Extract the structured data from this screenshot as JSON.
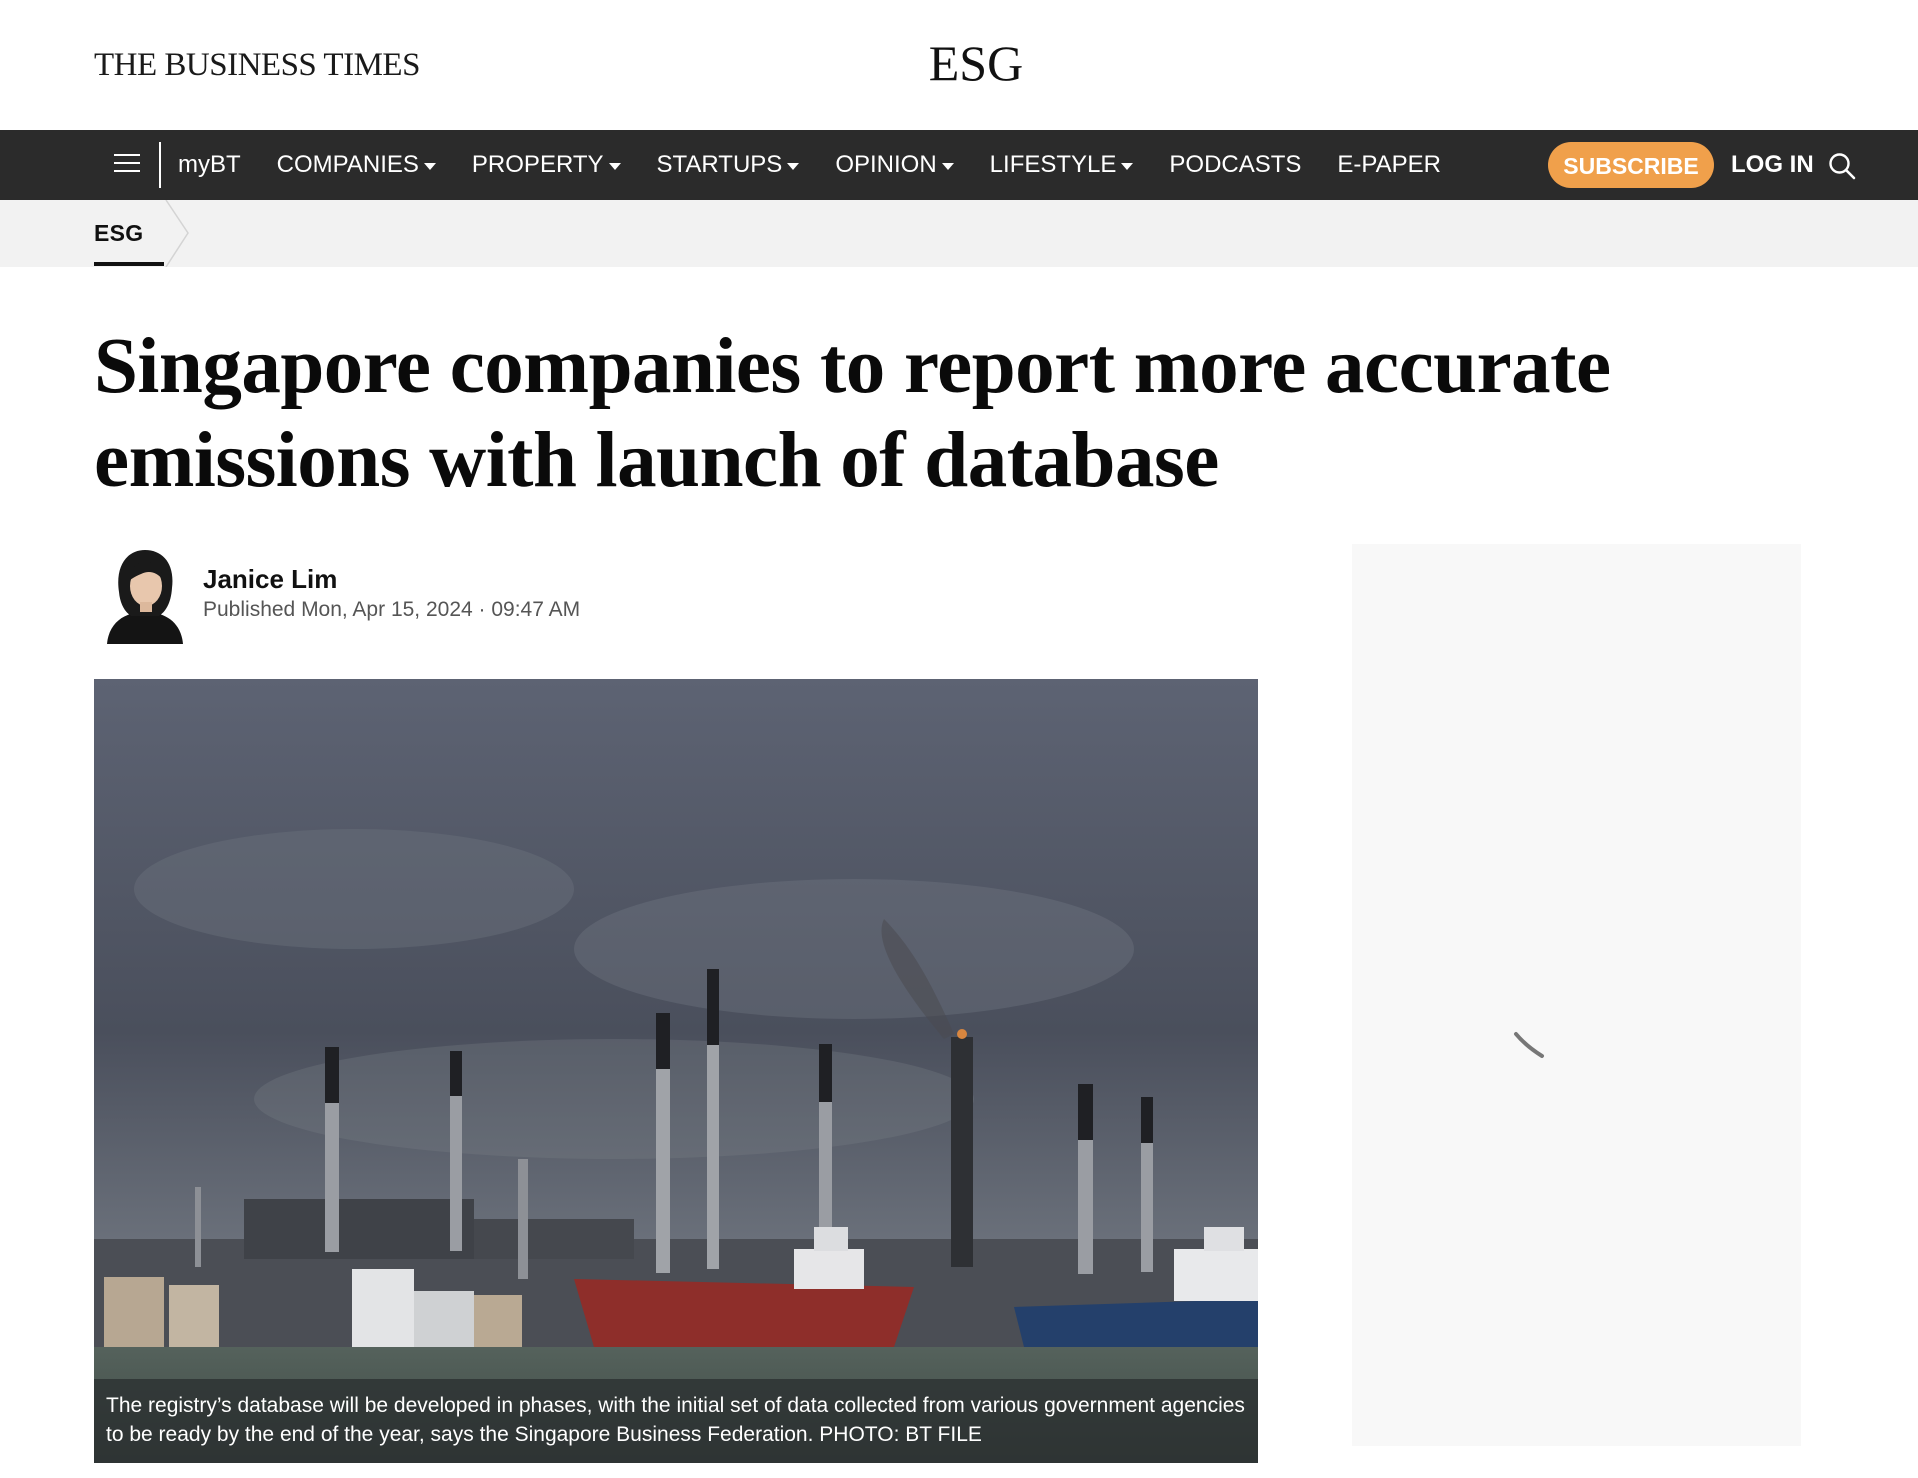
{
  "masthead": {
    "logo_text": "THE BUSINESS TIMES",
    "section_heading": "ESG"
  },
  "nav": {
    "mybt": "myBT",
    "items": [
      {
        "label": "COMPANIES",
        "dropdown": true
      },
      {
        "label": "PROPERTY",
        "dropdown": true
      },
      {
        "label": "STARTUPS",
        "dropdown": true
      },
      {
        "label": "OPINION",
        "dropdown": true
      },
      {
        "label": "LIFESTYLE",
        "dropdown": true
      },
      {
        "label": "PODCASTS",
        "dropdown": false
      },
      {
        "label": "E-PAPER",
        "dropdown": false
      }
    ],
    "subscribe_label": "SUBSCRIBE",
    "login_label": "LOG IN",
    "icons": {
      "menu": "hamburger-menu-icon",
      "search": "search-icon"
    }
  },
  "breadcrumb": {
    "label": "ESG"
  },
  "article": {
    "headline_line1": "Singapore companies to report more accurate",
    "headline_line2": "emissions with launch of database",
    "author": "Janice Lim",
    "published": "Published Mon, Apr 15, 2024 · 09:47 AM",
    "image_caption": "The registry’s database will be developed in phases, with the initial set of data collected from various government agencies to be ready by the end of the year, says the Singapore Business Federation. PHOTO: BT FILE"
  },
  "colors": {
    "nav_background": "#2b2b2b",
    "subscribe_accent": "#f0a04b",
    "breadcrumb_background": "#f2f2f2",
    "sidebar_placeholder": "#f8f8f8"
  }
}
